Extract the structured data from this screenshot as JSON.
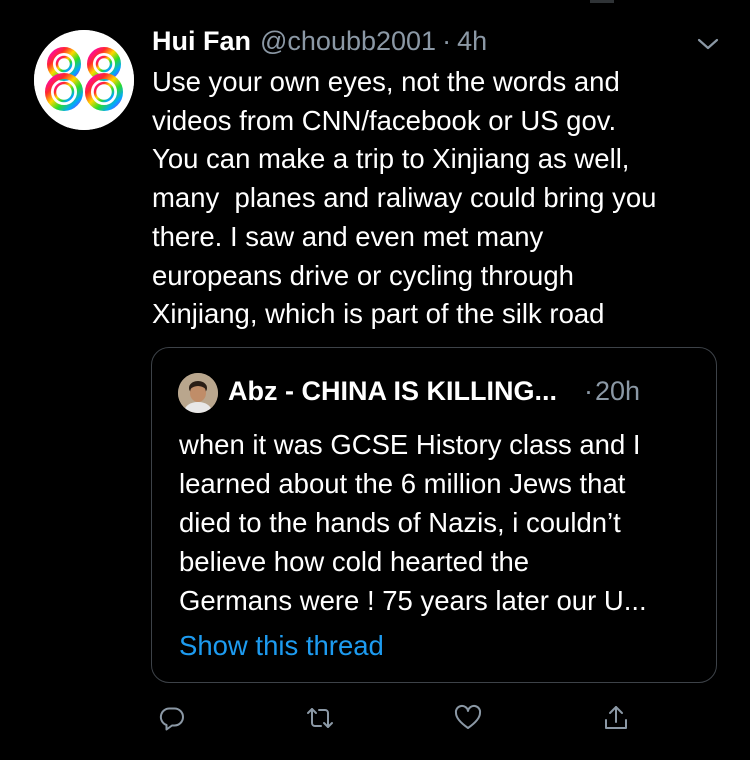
{
  "tweet": {
    "display_name": "Hui Fan",
    "handle": "@choubb2001",
    "separator": "·",
    "time": "4h",
    "text": "Use your own eyes, not the words and\nvideos from CNN/facebook or US gov.\nYou can make a trip to Xinjiang as well,\nmany  planes and raliway could bring you\nthere. I saw and even met many\neuropeans drive or cycling through\nXinjiang, which is part of the silk road"
  },
  "quoted": {
    "display_name": "Abz - CHINA IS KILLING...",
    "separator": "·",
    "time": "20h",
    "text": "when it was GCSE History class and I\nlearned about the 6 million Jews that\ndied to the hands of Nazis, i couldn’t\nbelieve how cold hearted the\nGermans were ! 75 years later our U...",
    "show_thread": "Show this thread"
  },
  "icons": {
    "caret": "chevron-down-icon",
    "reply": "reply-icon",
    "retweet": "retweet-icon",
    "like": "heart-icon",
    "share": "share-icon"
  },
  "colors": {
    "background": "#000000",
    "text": "#ffffff",
    "secondary": "#8b98a5",
    "link": "#1d9bf0",
    "border": "#3d4248"
  }
}
